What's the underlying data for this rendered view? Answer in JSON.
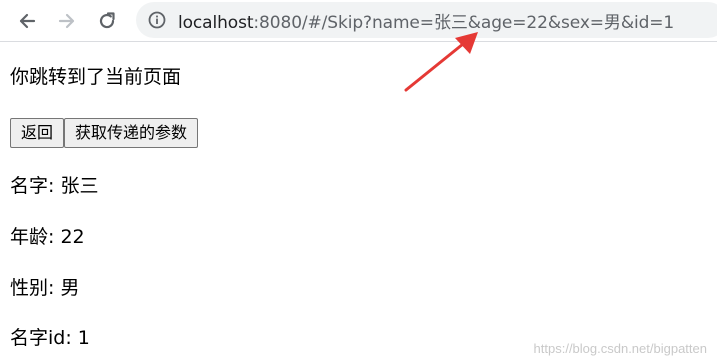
{
  "browser": {
    "url_host": "localhost",
    "url_rest": ":8080/#/Skip?name=张三&age=22&sex=男&id=1",
    "icons": {
      "back": "back-arrow-icon",
      "forward": "forward-arrow-icon",
      "reload": "reload-icon",
      "info": "info-icon"
    }
  },
  "page": {
    "heading": "你跳转到了当前页面",
    "buttons": {
      "back_label": "返回",
      "get_params_label": "获取传递的参数"
    },
    "fields": {
      "name": "名字: 张三",
      "age": "年龄: 22",
      "sex": "性别: 男",
      "id": "名字id: 1"
    }
  },
  "annotation": {
    "arrow_color": "#e53935"
  },
  "watermark": "https://blog.csdn.net/bigpatten"
}
